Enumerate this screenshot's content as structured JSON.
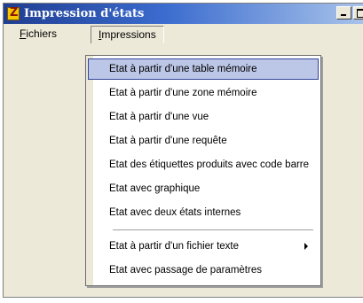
{
  "window": {
    "title": "Impression d'états",
    "icon": "z-app-icon"
  },
  "menubar": {
    "fichiers": "Fichiers",
    "fichiers_accel": "F",
    "fichiers_rest": "ichiers",
    "impressions": "Impressions",
    "impressions_accel": "I",
    "impressions_rest": "mpressions"
  },
  "dropdown": {
    "items": [
      {
        "label": "Etat à partir d'une table mémoire",
        "selected": true
      },
      {
        "label": "Etat à partir d'une zone mémoire"
      },
      {
        "label": "Etat à partir d'une vue"
      },
      {
        "label": "Etat à partir d'une requête"
      },
      {
        "label": "Etat des étiquettes produits avec code barre"
      },
      {
        "label": "Etat avec graphique"
      },
      {
        "label": "Etat avec deux états internes"
      },
      {
        "label": "Etat à partir d'un fichier texte",
        "submenu": true
      },
      {
        "label": "Etat avec passage de paramètres"
      }
    ]
  },
  "colors": {
    "selection_fill": "#bcc6e6",
    "selection_border": "#31469b",
    "titlebar_start": "#1f3d91",
    "titlebar_end": "#a8c3ea"
  }
}
